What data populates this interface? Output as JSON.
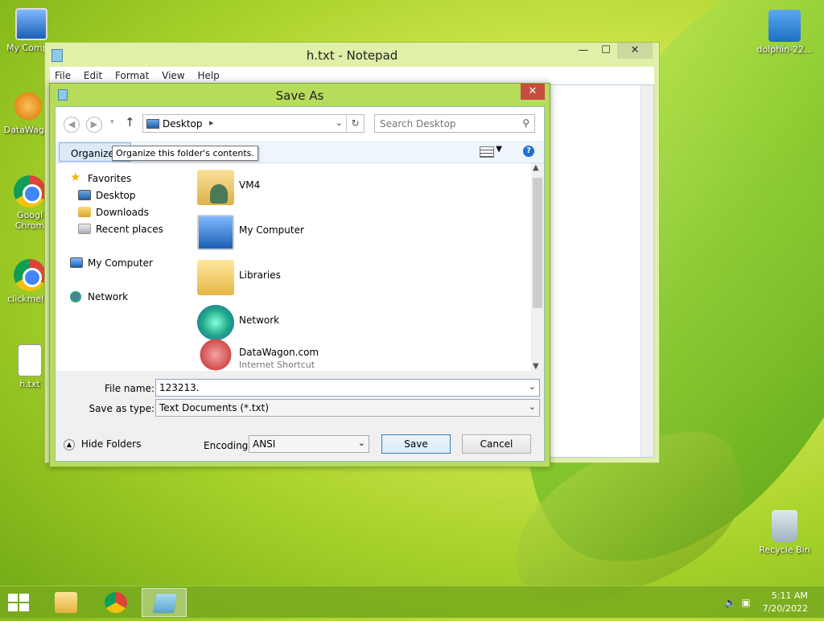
{
  "desktop": {
    "icons": [
      {
        "label": "My Comp..."
      },
      {
        "label": "DataWag..."
      },
      {
        "label": "Googl Chrom"
      },
      {
        "label": "clickmeI..."
      },
      {
        "label": "h.txt"
      },
      {
        "label": "dolphin-22..."
      },
      {
        "label": "Recycle Bin"
      }
    ]
  },
  "notepad": {
    "title": "h.txt - Notepad",
    "menu": [
      "File",
      "Edit",
      "Format",
      "View",
      "Help"
    ],
    "controls": {
      "minimize": "—",
      "maximize": "☐",
      "close": "✕"
    }
  },
  "dialog": {
    "title": "Save As",
    "close": "✕",
    "address": {
      "location": "Desktop"
    },
    "search": {
      "placeholder": "Search Desktop"
    },
    "toolbar": {
      "organize": "Organize",
      "tooltip": "Organize this folder's contents."
    },
    "nav": {
      "favorites": "Favorites",
      "desktop": "Desktop",
      "downloads": "Downloads",
      "recent": "Recent places",
      "my_computer": "My Computer",
      "network": "Network"
    },
    "files": [
      {
        "name": "VM4",
        "sub": ""
      },
      {
        "name": "My Computer",
        "sub": ""
      },
      {
        "name": "Libraries",
        "sub": ""
      },
      {
        "name": "Network",
        "sub": ""
      },
      {
        "name": "DataWagon.com",
        "sub": "Internet Shortcut"
      }
    ],
    "filename_label": "File name:",
    "filename_value": "123213.",
    "savetype_label": "Save as type:",
    "savetype_value": "Text Documents (*.txt)",
    "hide_folders": "Hide Folders",
    "encoding_label": "Encoding:",
    "encoding_value": "ANSI",
    "save": "Save",
    "cancel": "Cancel"
  },
  "taskbar": {
    "time": "5:11 AM",
    "date": "7/20/2022"
  }
}
